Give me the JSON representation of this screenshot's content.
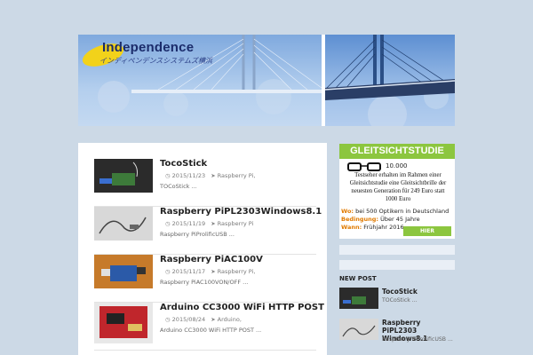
{
  "header": {
    "logo_title": "Independence",
    "logo_subtitle": "インディペンデンスシステムズ横浜"
  },
  "posts": [
    {
      "title": "TocoStick",
      "date": "2015/11/23",
      "category": "Raspberry Pi,",
      "excerpt": "TOCoStick ..."
    },
    {
      "title": "Raspberry PiPL2303Windows8.1",
      "date": "2015/11/19",
      "category": "Raspberry Pi",
      "excerpt": "Raspberry PiProlificUSB ..."
    },
    {
      "title": "Raspberry PiAC100V",
      "date": "2015/11/17",
      "category": "Raspberry Pi,",
      "excerpt": "Raspberry PiAC100VON/OFF ..."
    },
    {
      "title": "Arduino CC3000 WiFi HTTP POST",
      "date": "2015/08/24",
      "category": "Arduino,",
      "excerpt": "Arduino CC3000 WiFi HTTP POST ..."
    }
  ],
  "ad": {
    "headline": "GLEITSICHTSTUDIE",
    "count": "10.000",
    "text": "Testseher erhalten im Rahmen einer Gleitsichtstudie eine Gleitsichtbrille der neuesten Generation für 249 Euro statt 1000 Euro",
    "line1_label": "Wo:",
    "line1_value": "bei 500 Optikern in Deutschland",
    "line2_label": "Bedingung:",
    "line2_value": "Über 45 Jahre",
    "line3_label": "Wann:",
    "line3_value": "Frühjahr 2016",
    "button": "HIER ANMELDEN"
  },
  "sidebar": {
    "heading": "NEW POST",
    "items": [
      {
        "title": "TocoStick",
        "excerpt": "TOCoStick ..."
      },
      {
        "title": "Raspberry PiPL2303 Windows8.1",
        "excerpt": "Raspberry PiProlificUSB ..."
      }
    ]
  },
  "colors": {
    "page_bg": "#ccd9e6",
    "ad_green": "#8cc63f",
    "logo_yellow": "#f2d21a"
  }
}
